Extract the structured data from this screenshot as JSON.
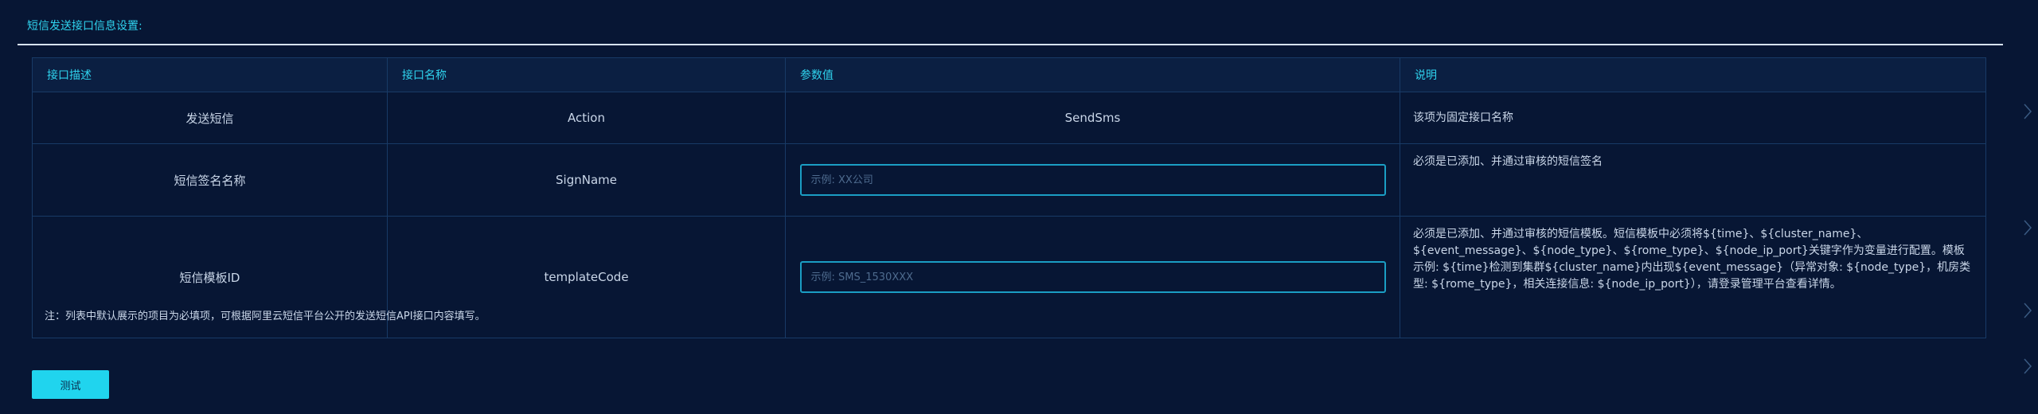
{
  "section": {
    "title": "短信发送接口信息设置:"
  },
  "table": {
    "headers": [
      "接口描述",
      "接口名称",
      "参数值",
      "说明"
    ],
    "rows": [
      {
        "desc": "发送短信",
        "name": "Action",
        "value": "SendSms",
        "note": "该项为固定接口名称"
      },
      {
        "desc": "短信签名名称",
        "name": "SignName",
        "placeholder": "示例: XX公司",
        "note": "必须是已添加、并通过审核的短信签名"
      },
      {
        "desc": "短信模板ID",
        "name": "templateCode",
        "placeholder": "示例: SMS_1530XXX",
        "note": "必须是已添加、并通过审核的短信模板。短信模板中必须将${time}、${cluster_name}、${event_message}、${node_type}、${rome_type}、${node_ip_port}关键字作为变量进行配置。模板示例: ${time}检测到集群${cluster_name}内出现${event_message}（异常对象: ${node_type}，机房类型: ${rome_type}，相关连接信息: ${node_ip_port}），请登录管理平台查看详情。"
      }
    ]
  },
  "footer": {
    "note": "注：列表中默认展示的项目为必填项，可根据阿里云短信平台公开的发送短信API接口内容填写。",
    "test_button": "测试"
  },
  "icons": [
    "chevron-right-icon"
  ],
  "colors": {
    "background": "#071634",
    "accent": "#20d4ee",
    "border": "#183a66"
  }
}
